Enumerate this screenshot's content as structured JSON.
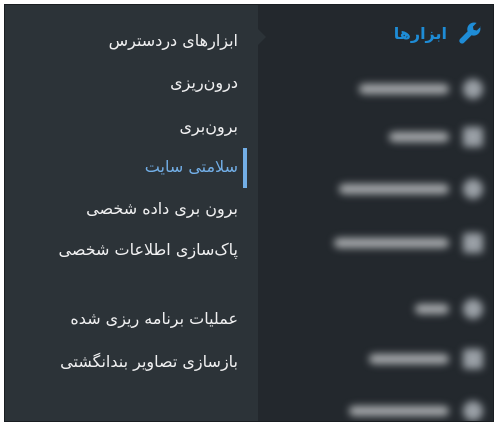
{
  "admin_menu": {
    "active_item": {
      "label": "ابزارها",
      "icon": "wrench-icon",
      "color": "#1e8cd6"
    }
  },
  "submenu": {
    "items": [
      {
        "label": "ابزارهای دردسترس"
      },
      {
        "label": "درون‌ریزی"
      },
      {
        "label": "برون‌بری"
      },
      {
        "label": "سلامتی سایت",
        "current": true
      },
      {
        "label": "برون بری داده شخصی"
      },
      {
        "label": "پاک‌سازی اطلاعات شخصی"
      },
      {
        "label": "عملیات برنامه ریزی شده"
      },
      {
        "label": "بازسازی تصاویر بندانگشتی"
      }
    ],
    "current_color": "#72aee6"
  }
}
